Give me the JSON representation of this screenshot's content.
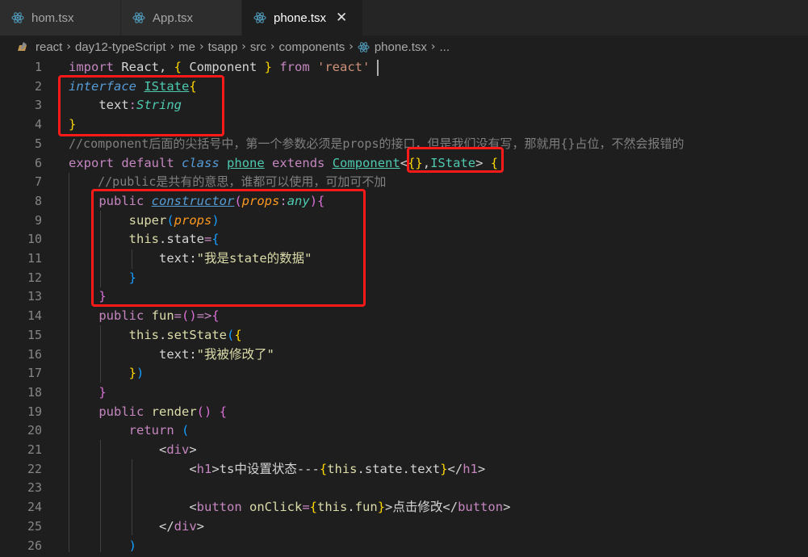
{
  "tabs": [
    {
      "label": "hom.tsx",
      "active": false
    },
    {
      "label": "App.tsx",
      "active": false
    },
    {
      "label": "phone.tsx",
      "active": true,
      "close": "✕"
    }
  ],
  "breadcrumb": [
    "react",
    "day12-typeScript",
    "me",
    "tsapp",
    "src",
    "components",
    "phone.tsx",
    "..."
  ],
  "colors": {
    "highlight_box": "#ff1a1a",
    "editor_bg": "#1e1e1e",
    "tab_bg": "#2d2d2d"
  },
  "line_numbers": [
    "1",
    "2",
    "3",
    "4",
    "5",
    "6",
    "7",
    "8",
    "9",
    "10",
    "11",
    "12",
    "13",
    "14",
    "15",
    "16",
    "17",
    "18",
    "19",
    "20",
    "21",
    "22",
    "23",
    "24",
    "25",
    "26"
  ],
  "code": {
    "l1": [
      "import",
      " React, ",
      "{",
      " Component ",
      "}",
      " from ",
      "'react'"
    ],
    "l2": [
      "interface",
      " ",
      "IState",
      "{"
    ],
    "l3": [
      "    text",
      ":",
      "String"
    ],
    "l4": [
      "}"
    ],
    "l5": "//component后面的尖括号中，第一个参数必须是props的接口，但是我们没有写，那就用{}占位，不然会报错的",
    "l6": [
      "export",
      " ",
      "default",
      " ",
      "class",
      " ",
      "phone",
      " ",
      "extends",
      " ",
      "Component",
      "<",
      "{}",
      ",",
      "IState",
      ">",
      " ",
      "{"
    ],
    "l7": "    //public是共有的意思，谁都可以使用，可加可不加",
    "l8": [
      "    ",
      "public",
      " ",
      "constructor",
      "(",
      "props",
      ":",
      "any",
      ")",
      "{"
    ],
    "l9": [
      "        ",
      "super",
      "(",
      "props",
      ")"
    ],
    "l10": [
      "        ",
      "this",
      ".",
      "state",
      "=",
      "{"
    ],
    "l11": [
      "            ",
      "text",
      ":",
      "\"我是state的数据\""
    ],
    "l12": [
      "        ",
      "}"
    ],
    "l13": [
      "    ",
      "}"
    ],
    "l14": [
      "    ",
      "public",
      " ",
      "fun",
      "=",
      "()",
      "=>",
      "{"
    ],
    "l15": [
      "        ",
      "this",
      ".",
      "setState",
      "(",
      "{"
    ],
    "l16": [
      "            ",
      "text",
      ":",
      "\"我被修改了\""
    ],
    "l17": [
      "        ",
      "}",
      ")"
    ],
    "l18": [
      "    ",
      "}"
    ],
    "l19": [
      "    ",
      "public",
      " ",
      "render",
      "()",
      " ",
      "{"
    ],
    "l20": [
      "        ",
      "return",
      " ",
      "("
    ],
    "l21": [
      "            ",
      "<",
      "div",
      ">"
    ],
    "l22": [
      "                ",
      "<",
      "h1",
      ">",
      "ts中设置状态---",
      "{",
      "this",
      ".",
      "state",
      ".",
      "text",
      "}",
      "</",
      "h1",
      ">"
    ],
    "l23": [
      ""
    ],
    "l24": [
      "                ",
      "<",
      "button",
      " ",
      "onClick",
      "=",
      "{",
      "this",
      ".",
      "fun",
      "}",
      ">",
      "点击修改",
      "</",
      "button",
      ">"
    ],
    "l25": [
      "            ",
      "</",
      "div",
      ">"
    ],
    "l26": [
      "        ",
      ")"
    ]
  }
}
